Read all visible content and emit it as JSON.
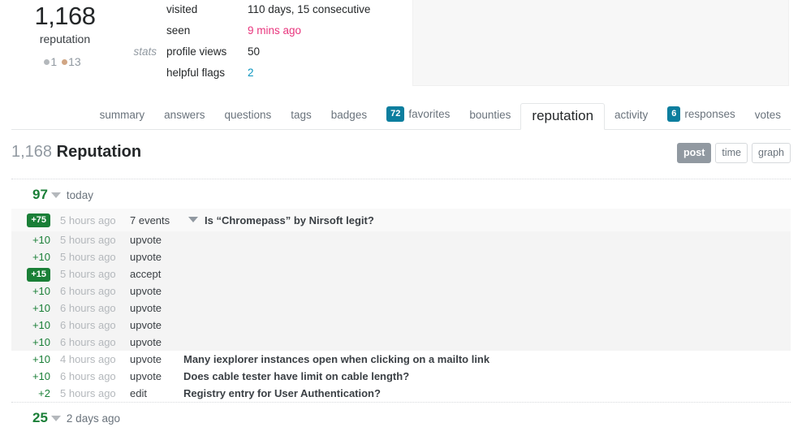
{
  "profile": {
    "reputation_number": "1,168",
    "reputation_label": "reputation",
    "badges": {
      "silver": "1",
      "bronze": "13"
    },
    "stats_label": "stats",
    "rows": [
      {
        "name": "visited",
        "value": "110 days, 15 consecutive",
        "style": "plain"
      },
      {
        "name": "seen",
        "value": "9 mins ago",
        "style": "pink"
      },
      {
        "name": "profile views",
        "value": "50",
        "style": "plain"
      },
      {
        "name": "helpful flags",
        "value": "2",
        "style": "link"
      }
    ]
  },
  "tabs": [
    {
      "label": "summary",
      "count": null,
      "active": false
    },
    {
      "label": "answers",
      "count": null,
      "active": false
    },
    {
      "label": "questions",
      "count": null,
      "active": false
    },
    {
      "label": "tags",
      "count": null,
      "active": false
    },
    {
      "label": "badges",
      "count": null,
      "active": false
    },
    {
      "label": "favorites",
      "count": "72",
      "active": false
    },
    {
      "label": "bounties",
      "count": null,
      "active": false
    },
    {
      "label": "reputation",
      "count": null,
      "active": true
    },
    {
      "label": "activity",
      "count": null,
      "active": false
    },
    {
      "label": "responses",
      "count": "6",
      "active": false
    },
    {
      "label": "votes",
      "count": null,
      "active": false
    }
  ],
  "page": {
    "title_number": "1,168",
    "title_text": "Reputation"
  },
  "view_switch": [
    {
      "label": "post",
      "active": true
    },
    {
      "label": "time",
      "active": false
    },
    {
      "label": "graph",
      "active": false
    }
  ],
  "days": [
    {
      "total": "97",
      "label": "today",
      "group": {
        "points": "+75",
        "badge": true,
        "when": "5 hours ago",
        "what": "7 events",
        "title": "Is “Chromepass” by Nirsoft legit?"
      },
      "group_events": [
        {
          "points": "+10",
          "badge": false,
          "when": "5 hours ago",
          "what": "upvote",
          "title": ""
        },
        {
          "points": "+10",
          "badge": false,
          "when": "5 hours ago",
          "what": "upvote",
          "title": ""
        },
        {
          "points": "+15",
          "badge": true,
          "when": "5 hours ago",
          "what": "accept",
          "title": ""
        },
        {
          "points": "+10",
          "badge": false,
          "when": "6 hours ago",
          "what": "upvote",
          "title": ""
        },
        {
          "points": "+10",
          "badge": false,
          "when": "6 hours ago",
          "what": "upvote",
          "title": ""
        },
        {
          "points": "+10",
          "badge": false,
          "when": "6 hours ago",
          "what": "upvote",
          "title": ""
        },
        {
          "points": "+10",
          "badge": false,
          "when": "6 hours ago",
          "what": "upvote",
          "title": ""
        }
      ],
      "events": [
        {
          "points": "+10",
          "badge": false,
          "when": "4 hours ago",
          "what": "upvote",
          "title": "Many iexplorer instances open when clicking on a mailto link"
        },
        {
          "points": "+10",
          "badge": false,
          "when": "6 hours ago",
          "what": "upvote",
          "title": "Does cable tester have limit on cable length?"
        },
        {
          "points": "+2",
          "badge": false,
          "when": "5 hours ago",
          "what": "edit",
          "title": "Registry entry for User Authentication?"
        }
      ]
    },
    {
      "total": "25",
      "label": "2 days ago",
      "group": null,
      "group_events": [],
      "events": []
    }
  ]
}
